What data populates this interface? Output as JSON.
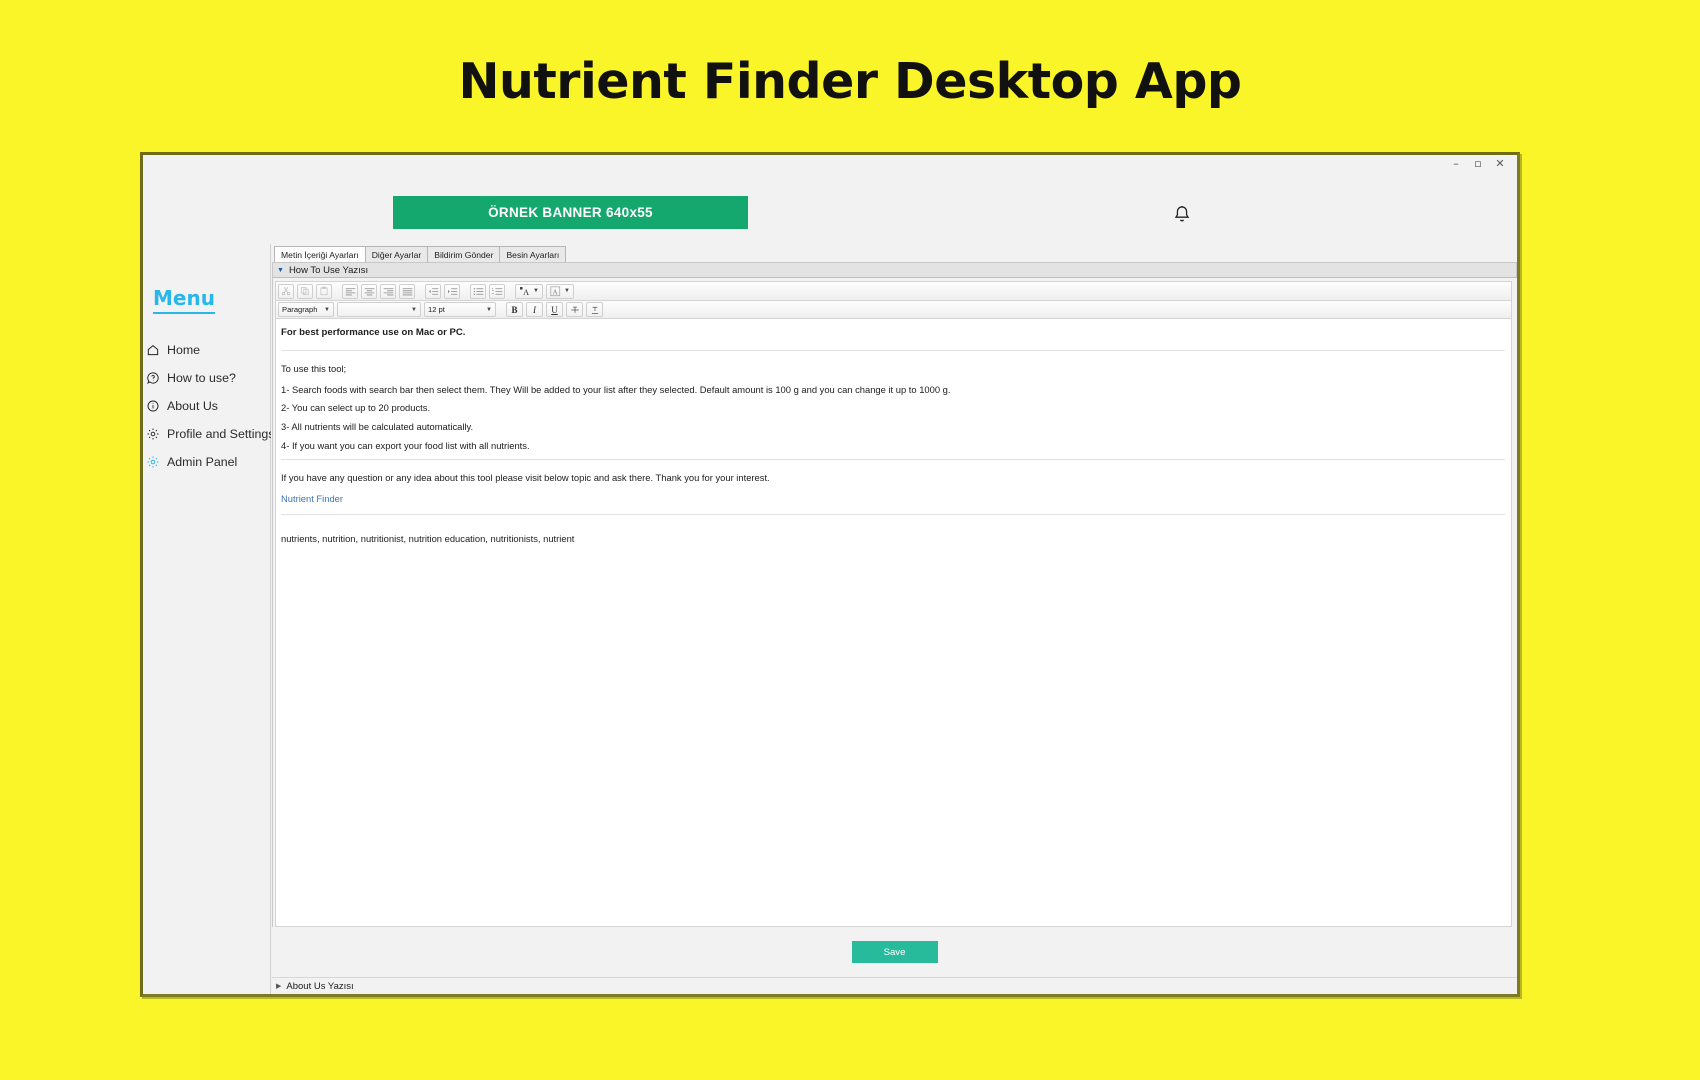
{
  "page": {
    "heading": "Nutrient Finder Desktop App",
    "background_color": "#faf528"
  },
  "window": {
    "controls": {
      "minimize": "–",
      "maximize": "▫",
      "close": "✕"
    },
    "border_color": "#6f6c18"
  },
  "topbar": {
    "banner_label": "ÖRNEK BANNER 640x55",
    "banner_color": "#14a86e",
    "notification_icon": "bell-icon"
  },
  "sidebar": {
    "title": "Menu",
    "accent_color": "#29b6e8",
    "items": [
      {
        "label": "Home",
        "icon": "home-icon",
        "accent": false
      },
      {
        "label": "How to use?",
        "icon": "question-circle-icon",
        "accent": false
      },
      {
        "label": "About Us",
        "icon": "info-circle-icon",
        "accent": false
      },
      {
        "label": "Profile and Settings",
        "icon": "gear-icon",
        "accent": false
      },
      {
        "label": "Admin Panel",
        "icon": "gear-icon",
        "accent": true
      }
    ]
  },
  "main": {
    "tabs": [
      {
        "label": "Metin İçeriği Ayarları",
        "active": true
      },
      {
        "label": "Diğer Ayarlar",
        "active": false
      },
      {
        "label": "Bildirim Gönder",
        "active": false
      },
      {
        "label": "Besin Ayarları",
        "active": false
      }
    ],
    "section_expanded": {
      "label": "How To Use Yazısı",
      "marker": "▼"
    },
    "section_collapsed": {
      "label": "About Us Yazısı",
      "marker": "▶"
    },
    "save_label": "Save",
    "save_color": "#27bb9b"
  },
  "editor": {
    "toolbar_row1": [
      {
        "name": "cut-icon",
        "glyph": "✂",
        "disabled": true
      },
      {
        "name": "copy-icon",
        "glyph": "❐",
        "disabled": true
      },
      {
        "name": "paste-icon",
        "glyph": "Ὄb",
        "disabled": true
      },
      {
        "name": "align-left-icon",
        "glyph": "",
        "disabled": false
      },
      {
        "name": "align-center-icon",
        "glyph": "",
        "disabled": false
      },
      {
        "name": "align-right-icon",
        "glyph": "",
        "disabled": false
      },
      {
        "name": "align-justify-icon",
        "glyph": "",
        "disabled": false
      },
      {
        "name": "outdent-icon",
        "glyph": "",
        "disabled": false
      },
      {
        "name": "indent-icon",
        "glyph": "",
        "disabled": false
      },
      {
        "name": "bullet-list-icon",
        "glyph": "",
        "disabled": false
      },
      {
        "name": "numbered-list-icon",
        "glyph": "",
        "disabled": false
      },
      {
        "name": "text-color-icon",
        "glyph": "A",
        "disabled": false
      },
      {
        "name": "highlight-color-icon",
        "glyph": "A",
        "disabled": false
      }
    ],
    "paragraph_style": "Paragraph",
    "font_family": "",
    "font_size": "12 pt",
    "format_buttons": [
      {
        "name": "bold-button",
        "label": "B"
      },
      {
        "name": "italic-button",
        "label": "I"
      },
      {
        "name": "underline-button",
        "label": "U"
      },
      {
        "name": "strikethrough-button",
        "label": "S"
      },
      {
        "name": "subscript-button",
        "label": "x"
      }
    ],
    "document": {
      "lead": "For best performance use on Mac or PC.",
      "intro": "To use this tool;",
      "steps": [
        "1- Search foods with search bar then select them. They Will be added to your list after they selected. Default amount is 100 g and you can change it up to 1000 g.",
        "2- You can select up to 20 products.",
        "3- All nutrients will be calculated automatically.",
        "4- If you want you can export your food list with all nutrients."
      ],
      "closing": "If you have any question or any idea about this tool please visit below topic and ask there. Thank you for your interest.",
      "link_text": "Nutrient Finder",
      "keywords": "nutrients, nutrition, nutritionist, nutrition education, nutritionists, nutrient"
    }
  }
}
